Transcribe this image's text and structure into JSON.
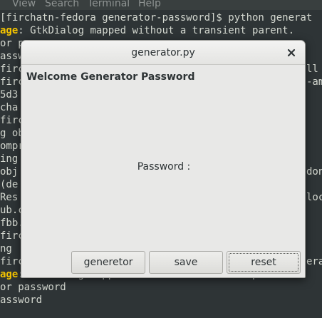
{
  "terminal": {
    "menu": [
      "View",
      "Search",
      "Terminal",
      "Help"
    ],
    "lines": [
      {
        "prefix": "",
        "warn": "",
        "text": "[firchatn-fedora generator-password]$ python generat"
      },
      {
        "prefix": "",
        "warn": "age",
        "text": ": GtkDialog mapped without a transient parent."
      },
      {
        "prefix": "",
        "warn": "",
        "text": "or p"
      },
      {
        "prefix": "",
        "warn": "",
        "text": "assw"
      },
      {
        "prefix": "",
        "warn": "",
        "text": "firc"
      },
      {
        "prefix": "",
        "warn": "",
        "text": "firc"
      },
      {
        "prefix": "",
        "warn": "",
        "text": "5d3"
      },
      {
        "prefix": "",
        "warn": "",
        "text": "cha"
      },
      {
        "prefix": "",
        "warn": "",
        "text": "firc"
      },
      {
        "prefix": "",
        "warn": "",
        "text": "g ob"
      },
      {
        "prefix": "",
        "warn": "",
        "text": "ompr"
      },
      {
        "prefix": "",
        "warn": "",
        "text": "ing"
      },
      {
        "prefix": "",
        "warn": "",
        "text": "obj"
      },
      {
        "prefix": "",
        "warn": "",
        "text": "(de"
      },
      {
        "prefix": "",
        "warn": "",
        "text": "Res"
      },
      {
        "prefix": "",
        "warn": "",
        "text": "ub.c"
      },
      {
        "prefix": "",
        "warn": "",
        "text": "fbb."
      },
      {
        "prefix": "",
        "warn": "",
        "text": "firc"
      },
      {
        "prefix": "",
        "warn": "",
        "text": "ng"
      },
      {
        "prefix": "",
        "warn": "",
        "text": "firc"
      },
      {
        "prefix": "",
        "warn": "age",
        "text": ": GtkDialog mapped without a transient parent."
      },
      {
        "prefix": "",
        "warn": "",
        "text": "or password"
      },
      {
        "prefix": "",
        "warn": "",
        "text": "assword"
      }
    ],
    "right_fragments": [
      {
        "row": 4,
        "text": "ll"
      },
      {
        "row": 5,
        "text": "-am"
      },
      {
        "row": 12,
        "text": "don"
      },
      {
        "row": 14,
        "text": "loc"
      },
      {
        "row": 19,
        "text": "erat"
      }
    ]
  },
  "dialog": {
    "title": "generator.py",
    "close_icon": "close-icon",
    "welcome": "Welcome Generator Password",
    "password_label": "Password :",
    "buttons": {
      "generate": "generetor",
      "save": "save",
      "reset": "reset"
    }
  }
}
